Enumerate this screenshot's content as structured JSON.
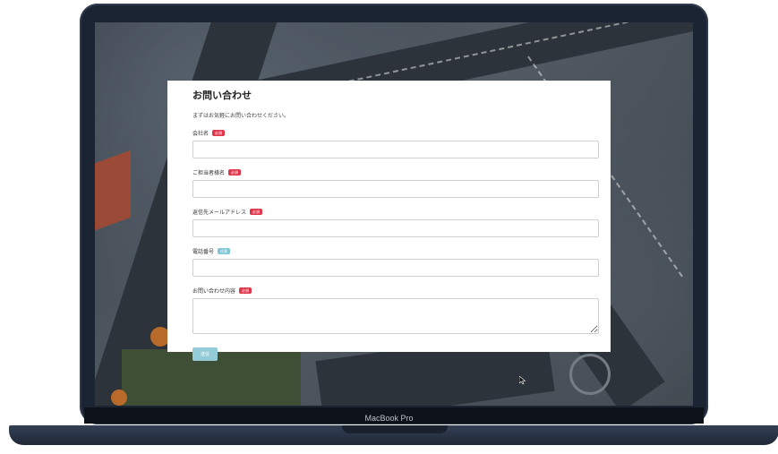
{
  "device": {
    "model_label": "MacBook Pro"
  },
  "form": {
    "title": "お問い合わせ",
    "intro": "まずはお気軽にお問い合わせください。",
    "fields": [
      {
        "label": "会社名",
        "badge": "必須",
        "kind": "input",
        "value": "",
        "placeholder": ""
      },
      {
        "label": "ご担当者様名",
        "badge": "必須",
        "kind": "input",
        "value": "",
        "placeholder": ""
      },
      {
        "label": "返信先メールアドレス",
        "badge": "必須",
        "kind": "input",
        "value": "",
        "placeholder": ""
      },
      {
        "label": "電話番号",
        "badge": "任意",
        "kind": "input",
        "value": "",
        "placeholder": ""
      },
      {
        "label": "お問い合わせ内容",
        "badge": "必須",
        "kind": "textarea",
        "value": "",
        "placeholder": ""
      }
    ],
    "submit_label": "送信"
  },
  "colors": {
    "required_badge": "#e0364b",
    "optional_badge": "#7fc7d6",
    "submit_button": "#93ccd8",
    "laptop_body": "#1b2433"
  },
  "icons": {
    "cursor": "arrow-cursor-icon"
  }
}
